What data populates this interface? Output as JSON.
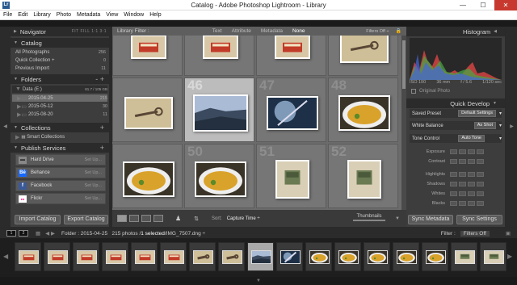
{
  "window": {
    "title": "Catalog - Adobe Photoshop Lightroom - Library",
    "app_icon": "Lr",
    "min": "—",
    "max": "☐",
    "close": "✕"
  },
  "menu": [
    "File",
    "Edit",
    "Library",
    "Photo",
    "Metadata",
    "View",
    "Window",
    "Help"
  ],
  "navigator": {
    "title": "Navigator",
    "views": "FIT  FILL  1:1  3:1"
  },
  "catalog": {
    "title": "Catalog",
    "items": [
      {
        "label": "All Photographs",
        "count": "256"
      },
      {
        "label": "Quick Collection +",
        "count": "0"
      },
      {
        "label": "Previous Import",
        "count": "11"
      }
    ]
  },
  "folders": {
    "title": "Folders",
    "volume": "Data (E:)",
    "volume_info": "81.7 / 105 GB",
    "items": [
      {
        "label": "2015-04-25",
        "count": "215"
      },
      {
        "label": "2015-05-12",
        "count": "30"
      },
      {
        "label": "2015-08-20",
        "count": "11"
      }
    ]
  },
  "collections": {
    "title": "Collections",
    "items": [
      {
        "label": "Smart Collections"
      }
    ]
  },
  "publish": {
    "title": "Publish Services",
    "items": [
      {
        "label": "Hard Drive",
        "setup": "Set Up...",
        "icon": "hdd-icon"
      },
      {
        "label": "Behance",
        "setup": "Set Up...",
        "icon": "behance-icon",
        "glyph": "Bē"
      },
      {
        "label": "Facebook",
        "setup": "Set Up...",
        "icon": "facebook-icon",
        "glyph": "f"
      },
      {
        "label": "Flickr",
        "setup": "Set Up...",
        "icon": "flickr-icon",
        "glyph": "●●"
      }
    ]
  },
  "buttons": {
    "import": "Import Catalog",
    "export": "Export Catalog",
    "sync_meta": "Sync Metadata",
    "sync_settings": "Sync Settings"
  },
  "filter": {
    "label": "Library Filter :",
    "options": [
      "Text",
      "Attribute",
      "Metadata",
      "None"
    ],
    "selected": "None",
    "filters_off": "Filters Off ÷"
  },
  "grid": {
    "cells": [
      {
        "num": "",
        "kind": "staples"
      },
      {
        "num": "",
        "kind": "staples"
      },
      {
        "num": "",
        "kind": "staples"
      },
      {
        "num": "",
        "kind": "key"
      },
      {
        "num": "",
        "kind": "key"
      },
      {
        "num": "46",
        "kind": "rocks",
        "selected": true
      },
      {
        "num": "47",
        "kind": "frost"
      },
      {
        "num": "48",
        "kind": "food"
      },
      {
        "num": "",
        "kind": "food"
      },
      {
        "num": "50",
        "kind": "food"
      },
      {
        "num": "51",
        "kind": "candy"
      },
      {
        "num": "52",
        "kind": "candy"
      }
    ]
  },
  "toolbar": {
    "sort_label": "Sort:",
    "sort_value": "Capture Time ÷",
    "thumbs_label": "Thumbnails"
  },
  "histogram": {
    "title": "Histogram",
    "iso": "ISO 100",
    "focal": "36 mm",
    "aperture": "f / 5.6",
    "shutter": "1/120 sec",
    "original": "Original Photo"
  },
  "quick_develop": {
    "title": "Quick Develop",
    "saved_preset": {
      "label": "Saved Preset",
      "value": "Default Settings"
    },
    "white_balance": {
      "label": "White Balance",
      "value": "As Shot"
    },
    "tone_control": {
      "label": "Tone Control",
      "value": "Auto Tone"
    },
    "adjustments": [
      "Exposure",
      "Contrast",
      "Highlights",
      "Shadows",
      "Whites",
      "Blacks"
    ]
  },
  "filmstrip": {
    "monitors": [
      "1",
      "2"
    ],
    "path_prefix": "Folder : 2015-04-25",
    "count": "215 photos /",
    "selected": "1 selected",
    "file": "/IMG_7507.dng ÷",
    "filter_label": "Filter :",
    "filter_value": "Filters Off"
  },
  "colors": {
    "panel": "#3d3d3d",
    "grid": "#6b6b6b",
    "selected": "#bcbcbc"
  }
}
